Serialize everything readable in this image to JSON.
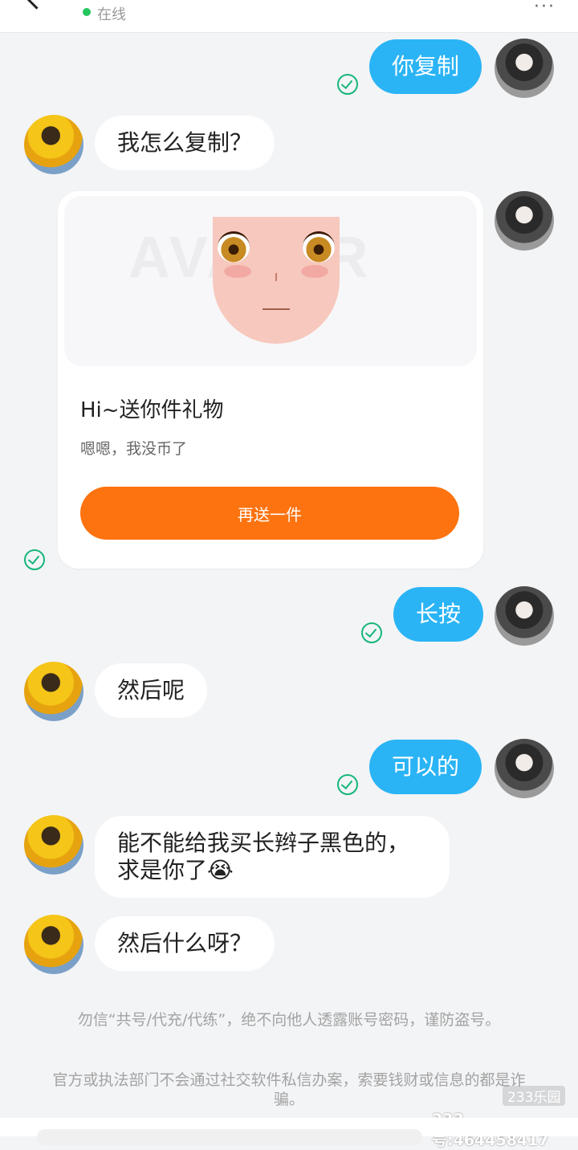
{
  "header": {
    "status": "在线"
  },
  "messages": [
    {
      "id": "m1",
      "text": "你复制"
    },
    {
      "id": "m2",
      "text": "我怎么复制？"
    },
    {
      "id": "m3",
      "text": "长按"
    },
    {
      "id": "m4",
      "text": "然后呢"
    },
    {
      "id": "m5",
      "text": "可以的"
    },
    {
      "id": "m6",
      "line1": "能不能给我买长辫子黑色的，",
      "line2": "求是你了😭"
    },
    {
      "id": "m7",
      "text": "然后什么呀？"
    }
  ],
  "gift_card": {
    "title": "Hi~送你件礼物",
    "subtitle": "嗯嗯，我没币了",
    "button": "再送一件",
    "button_color": "#fd7310"
  },
  "notices": [
    "勿信“共号/代充/代练”，绝不向他人透露账号密码，谨防盗号。",
    "官方或执法部门不会通过社交软件私信办案，索要钱财或信息的都是诈骗。"
  ],
  "watermark": {
    "logo": "233乐园",
    "id": "233号:464458417"
  },
  "colors": {
    "me_bubble": "#2ab4f5",
    "read_check": "#16b67a",
    "online": "#22c55e"
  }
}
